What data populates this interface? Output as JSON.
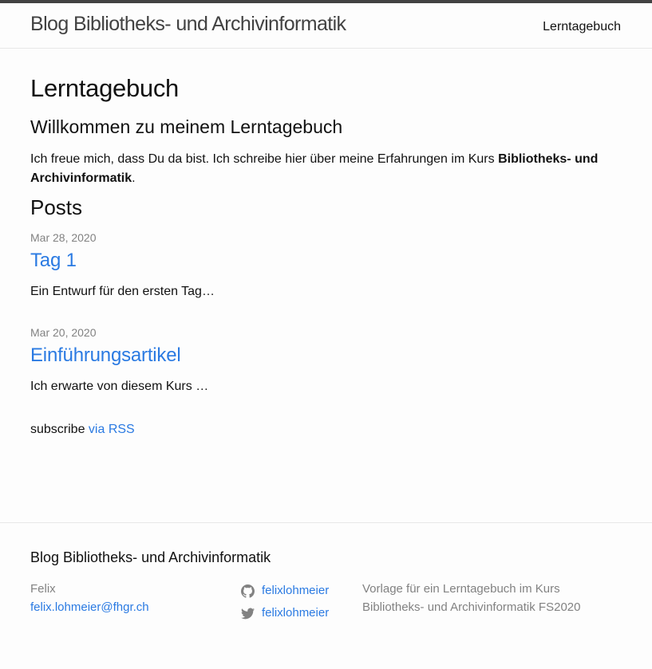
{
  "header": {
    "site_title": "Blog Bibliotheks- und Archivinformatik",
    "nav_item": "Lerntagebuch"
  },
  "main": {
    "page_heading": "Lerntagebuch",
    "welcome_heading": "Willkommen zu meinem Lerntagebuch",
    "intro_text": "Ich freue mich, dass Du da bist. Ich schreibe hier über meine Erfahrungen im Kurs ",
    "intro_bold": "Bibliotheks- und Archivinformatik",
    "intro_end": ".",
    "posts_heading": "Posts",
    "posts": [
      {
        "date": "Mar 28, 2020",
        "title": "Tag 1",
        "excerpt": "Ein Entwurf für den ersten Tag…"
      },
      {
        "date": "Mar 20, 2020",
        "title": "Einführungsartikel",
        "excerpt": "Ich erwarte von diesem Kurs …"
      }
    ],
    "subscribe_text": "subscribe ",
    "subscribe_link": "via RSS"
  },
  "footer": {
    "heading": "Blog Bibliotheks- und Archivinformatik",
    "name": "Felix",
    "email": "felix.lohmeier@fhgr.ch",
    "github_user": "felixlohmeier",
    "twitter_user": "felixlohmeier",
    "description": "Vorlage für ein Lerntagebuch im Kurs Bibliotheks- und Archivinformatik FS2020",
    "icons": {
      "github": "github-icon",
      "twitter": "twitter-icon"
    }
  },
  "colors": {
    "link": "#2a7ae2",
    "meta": "#828282",
    "topbar": "#424242"
  }
}
